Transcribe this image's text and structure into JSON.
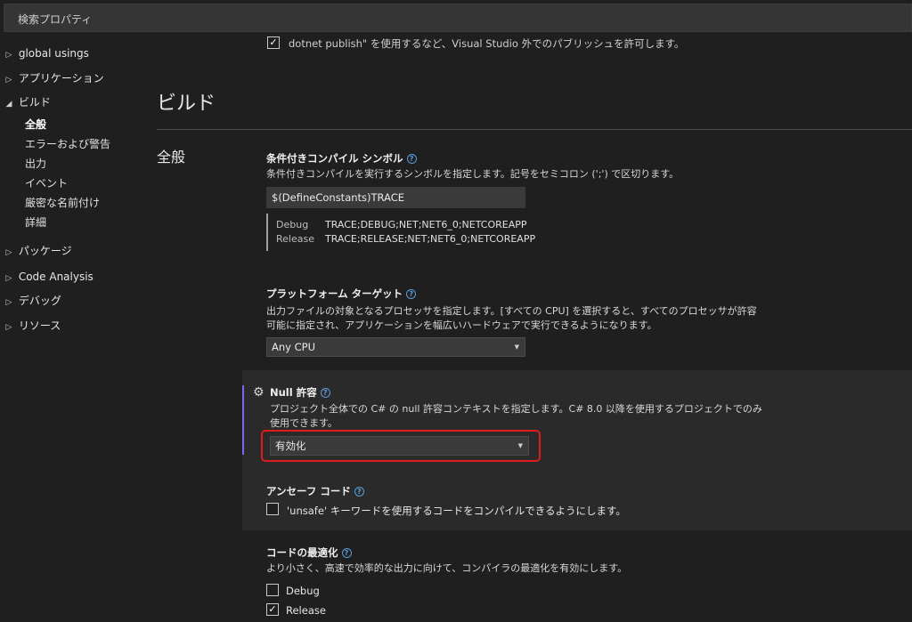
{
  "search": {
    "placeholder": "検索プロパティ"
  },
  "sidebar": {
    "items": [
      {
        "label": "global usings",
        "arrow": "▷"
      },
      {
        "label": "アプリケーション",
        "arrow": "▷"
      },
      {
        "label": "ビルド",
        "arrow": "◢"
      },
      {
        "label": "パッケージ",
        "arrow": "▷"
      },
      {
        "label": "Code Analysis",
        "arrow": "▷"
      },
      {
        "label": "デバッグ",
        "arrow": "▷"
      },
      {
        "label": "リソース",
        "arrow": "▷"
      }
    ],
    "build_children": [
      "全般",
      "エラーおよび警告",
      "出力",
      "イベント",
      "厳密な名前付け",
      "詳細"
    ]
  },
  "top_clipped": {
    "text": "dotnet publish\" を使用するなど、Visual Studio 外でのパブリッシュを許可します。",
    "checked": true
  },
  "main": {
    "section_title": "ビルド",
    "group_title": "全般",
    "conditional_symbols": {
      "title": "条件付きコンパイル シンボル",
      "description": "条件付きコンパイルを実行するシンボルを指定します。記号をセミコロン (';') で区切ります。",
      "value": "$(DefineConstants)TRACE",
      "evaluated": [
        {
          "config": "Debug",
          "value": "TRACE;DEBUG;NET;NET6_0;NETCOREAPP"
        },
        {
          "config": "Release",
          "value": "TRACE;RELEASE;NET;NET6_0;NETCOREAPP"
        }
      ]
    },
    "platform_target": {
      "title": "プラットフォーム ターゲット",
      "description_line1": "出力ファイルの対象となるプロセッサを指定します。[すべての CPU] を選択すると、すべてのプロセッサが許容",
      "description_line2": "可能に指定され、アプリケーションを幅広いハードウェアで実行できるようになります。",
      "value": "Any CPU"
    },
    "nullable": {
      "title": "Null 許容",
      "description_line1": "プロジェクト全体での C# の null 許容コンテキストを指定します。C# 8.0 以降を使用するプロジェクトでのみ",
      "description_line2": "使用できます。",
      "value": "有効化"
    },
    "unsafe_code": {
      "title": "アンセーフ コード",
      "checkbox_label": "'unsafe' キーワードを使用するコードをコンパイルできるようにします。",
      "checked": false
    },
    "optimize": {
      "title": "コードの最適化",
      "description": "より小さく、高速で効率的な出力に向けて、コンパイラの最適化を有効にします。",
      "options": [
        {
          "label": "Debug",
          "checked": false
        },
        {
          "label": "Release",
          "checked": true
        }
      ]
    }
  },
  "icons": {
    "info": "info-icon",
    "gear": "gear-icon",
    "caret": "caret-down-icon"
  },
  "colors": {
    "accent_bar": "#7b68ee",
    "highlight_outline": "#e01b1b",
    "info": "#5c9bd6"
  }
}
